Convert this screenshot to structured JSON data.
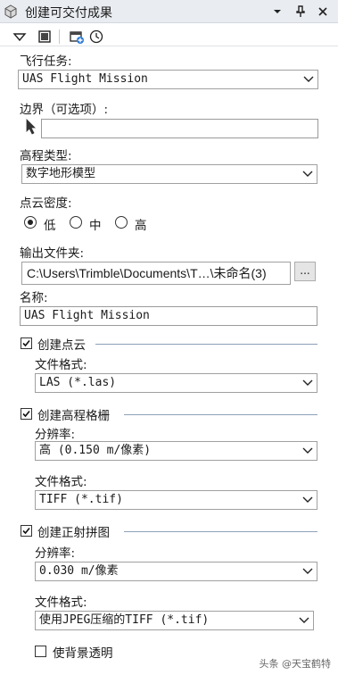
{
  "window": {
    "title": "创建可交付成果",
    "title_icon": "cube-icon",
    "buttons": [
      "dropdown-arrow",
      "pin-icon",
      "close-icon"
    ]
  },
  "toolbar": {
    "tools": [
      "dropdown-arrow-icon",
      "window-icon",
      "add-layer-icon",
      "history-clock-icon"
    ]
  },
  "flight_mission": {
    "label": "飞行任务:",
    "value": "UAS Flight Mission"
  },
  "boundary": {
    "label": "边界（可选项）:",
    "value": ""
  },
  "elevation_type": {
    "label": "高程类型:",
    "value": "数字地形模型"
  },
  "point_density": {
    "label": "点云密度:",
    "options": [
      "低",
      "中",
      "高"
    ],
    "selected": "低"
  },
  "output_folder": {
    "label": "输出文件夹:",
    "value": "C:\\Users\\Trimble\\Documents\\T…\\未命名(3)",
    "browse_label": "..."
  },
  "name": {
    "label": "名称:",
    "value": "UAS Flight Mission"
  },
  "point_cloud": {
    "label": "创建点云",
    "checked": true,
    "format_label": "文件格式:",
    "format_value": "LAS (*.las)"
  },
  "elevation_grid": {
    "label": "创建高程格栅",
    "checked": true,
    "resolution_label": "分辨率:",
    "resolution_value": "高 (0.150 m/像素)",
    "format_label": "文件格式:",
    "format_value": "TIFF (*.tif)"
  },
  "orthomosaic": {
    "label": "创建正射拼图",
    "checked": true,
    "resolution_label": "分辨率:",
    "resolution_value": "0.030 m/像素",
    "format_label": "文件格式:",
    "format_value": "使用JPEG压缩的TIFF (*.tif)",
    "transparent_label": "使背景透明",
    "transparent_checked": false
  },
  "watermark": "头条 @天宝鹤特"
}
